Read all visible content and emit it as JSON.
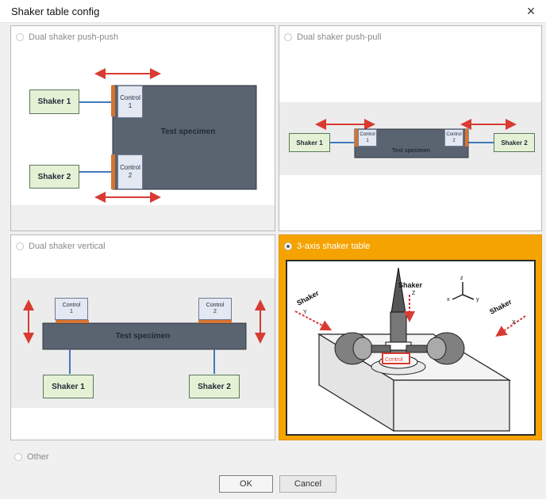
{
  "window": {
    "title": "Shaker table config",
    "close_icon": "close-icon"
  },
  "options": {
    "dual_push_push": {
      "label": "Dual shaker push-push",
      "selected": false,
      "diagram": {
        "shaker1": "Shaker 1",
        "shaker2": "Shaker 2",
        "control1": "Control\n1",
        "control2": "Control\n2",
        "specimen": "Test specimen"
      }
    },
    "dual_push_pull": {
      "label": "Dual shaker push-pull",
      "selected": false,
      "diagram": {
        "shaker1": "Shaker 1",
        "shaker2": "Shaker 2",
        "control1": "Control\n1",
        "control2": "Control\n2",
        "specimen": "Test specimen"
      }
    },
    "dual_vertical": {
      "label": "Dual shaker vertical",
      "selected": false,
      "diagram": {
        "shaker1": "Shaker 1",
        "shaker2": "Shaker 2",
        "control1": "Control\n1",
        "control2": "Control\n2",
        "specimen": "Test specimen"
      }
    },
    "three_axis": {
      "label": "3-axis shaker table",
      "selected": true,
      "diagram": {
        "shaker_z": "Shaker",
        "shaker_z_axis": "Z",
        "shaker_y": "Shaker",
        "shaker_y_axis": "Y",
        "shaker_x": "Shaker",
        "shaker_x_axis": "X",
        "control": "Control",
        "axis_x": "x",
        "axis_y": "y",
        "axis_z": "z"
      }
    },
    "other": {
      "label": "Other",
      "selected": false
    }
  },
  "buttons": {
    "ok": "OK",
    "cancel": "Cancel"
  },
  "colors": {
    "selected_panel": "#f5a300",
    "arrow_red": "#d83b32",
    "shaker_fill": "#e5f1d5",
    "control_fill": "#e3e8f2",
    "specimen_dark": "#4d5662"
  }
}
